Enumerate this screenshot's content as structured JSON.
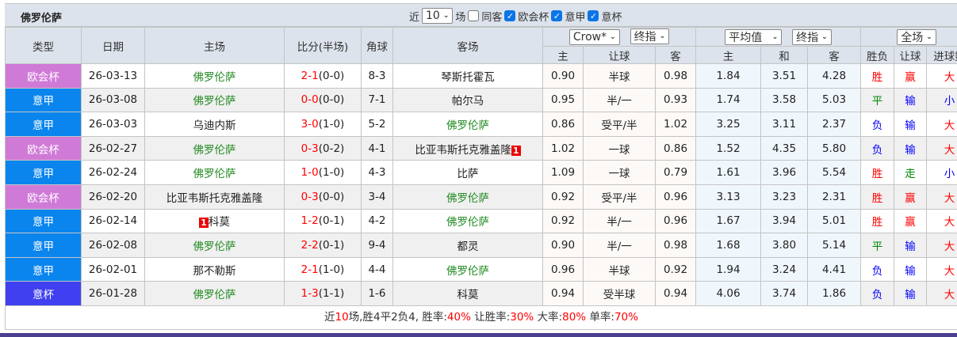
{
  "header": {
    "team": "佛罗伦萨",
    "recent_label": "近",
    "recent_value": "10",
    "recent_unit": "场",
    "same_home_label": "同客",
    "same_home_checked": false,
    "filters": [
      {
        "label": "欧会杯",
        "checked": true
      },
      {
        "label": "意甲",
        "checked": true
      },
      {
        "label": "意杯",
        "checked": true
      }
    ]
  },
  "columns": {
    "type": "类型",
    "date": "日期",
    "home": "主场",
    "score": "比分(半场)",
    "corner": "角球",
    "away": "客场",
    "company1": "Crow*",
    "odds1": "终指",
    "company2": "平均值",
    "odds2": "终指",
    "period": "全场",
    "sub": [
      "主",
      "让球",
      "客",
      "主",
      "和",
      "客",
      "胜负",
      "让球",
      "进球数"
    ]
  },
  "type_colors": {
    "欧会杯": "#d07ad8",
    "意甲": "#0a85ee",
    "意杯": "#4040f0"
  },
  "rows": [
    {
      "type": "欧会杯",
      "date": "26-03-13",
      "home": "佛罗伦萨",
      "ft": "2-1",
      "ht": "(0-0)",
      "corner": "8-3",
      "away": "琴斯托霍瓦",
      "h": "0.90",
      "hcp": "半球",
      "a": "0.98",
      "eh": "1.84",
      "ed": "3.51",
      "ea": "4.28",
      "res": "胜",
      "hres": "赢",
      "ou": "大"
    },
    {
      "type": "意甲",
      "date": "26-03-08",
      "home": "佛罗伦萨",
      "ft": "0-0",
      "ht": "(0-0)",
      "corner": "7-1",
      "away": "帕尔马",
      "h": "0.95",
      "hcp": "半/一",
      "a": "0.93",
      "eh": "1.74",
      "ed": "3.58",
      "ea": "5.03",
      "res": "平",
      "hres": "输",
      "ou": "小"
    },
    {
      "type": "意甲",
      "date": "26-03-03",
      "home": "乌迪内斯",
      "ft": "3-0",
      "ht": "(1-0)",
      "corner": "5-2",
      "away": "佛罗伦萨",
      "h": "0.86",
      "hcp": "受平/半",
      "a": "1.02",
      "eh": "3.25",
      "ed": "3.11",
      "ea": "2.37",
      "res": "负",
      "hres": "输",
      "ou": "大"
    },
    {
      "type": "欧会杯",
      "date": "26-02-27",
      "home": "佛罗伦萨",
      "ft": "0-3",
      "ht": "(0-2)",
      "corner": "4-1",
      "away": "比亚韦斯托克雅盖隆",
      "away_badge": "1",
      "h": "1.02",
      "hcp": "一球",
      "a": "0.86",
      "eh": "1.52",
      "ed": "4.35",
      "ea": "5.80",
      "res": "负",
      "hres": "输",
      "ou": "大"
    },
    {
      "type": "意甲",
      "date": "26-02-24",
      "home": "佛罗伦萨",
      "ft": "1-0",
      "ht": "(1-0)",
      "corner": "4-3",
      "away": "比萨",
      "h": "1.09",
      "hcp": "一球",
      "a": "0.79",
      "eh": "1.61",
      "ed": "3.96",
      "ea": "5.54",
      "res": "胜",
      "hres": "走",
      "ou": "小"
    },
    {
      "type": "欧会杯",
      "date": "26-02-20",
      "home": "比亚韦斯托克雅盖隆",
      "ft": "0-3",
      "ht": "(0-0)",
      "corner": "3-4",
      "away": "佛罗伦萨",
      "h": "0.92",
      "hcp": "受平/半",
      "a": "0.96",
      "eh": "3.13",
      "ed": "3.23",
      "ea": "2.31",
      "res": "胜",
      "hres": "赢",
      "ou": "大"
    },
    {
      "type": "意甲",
      "date": "26-02-14",
      "home": "科莫",
      "home_badge": "1",
      "ft": "1-2",
      "ht": "(0-1)",
      "corner": "4-2",
      "away": "佛罗伦萨",
      "h": "0.92",
      "hcp": "半/一",
      "a": "0.96",
      "eh": "1.67",
      "ed": "3.94",
      "ea": "5.01",
      "res": "胜",
      "hres": "赢",
      "ou": "大"
    },
    {
      "type": "意甲",
      "date": "26-02-08",
      "home": "佛罗伦萨",
      "ft": "2-2",
      "ht": "(0-1)",
      "corner": "9-4",
      "away": "都灵",
      "h": "0.90",
      "hcp": "半/一",
      "a": "0.98",
      "eh": "1.68",
      "ed": "3.80",
      "ea": "5.14",
      "res": "平",
      "hres": "输",
      "ou": "大"
    },
    {
      "type": "意甲",
      "date": "26-02-01",
      "home": "那不勒斯",
      "ft": "2-1",
      "ht": "(1-0)",
      "corner": "4-4",
      "away": "佛罗伦萨",
      "h": "0.96",
      "hcp": "半球",
      "a": "0.92",
      "eh": "1.94",
      "ed": "3.24",
      "ea": "4.41",
      "res": "负",
      "hres": "输",
      "ou": "大"
    },
    {
      "type": "意杯",
      "date": "26-01-28",
      "home": "佛罗伦萨",
      "ft": "1-3",
      "ht": "(1-1)",
      "corner": "1-6",
      "away": "科莫",
      "h": "0.94",
      "hcp": "受半球",
      "a": "0.94",
      "eh": "4.06",
      "ed": "3.74",
      "ea": "1.86",
      "res": "负",
      "hres": "输",
      "ou": "大"
    }
  ],
  "footer": {
    "p1": "近",
    "n": "10",
    "p2": "场,胜4平2负4, 胜率:",
    "win": "40%",
    "p3": " 让胜率:",
    "hwin": "30%",
    "p4": " 大率:",
    "big": "80%",
    "p5": " 单率:",
    "odd": "70%"
  }
}
